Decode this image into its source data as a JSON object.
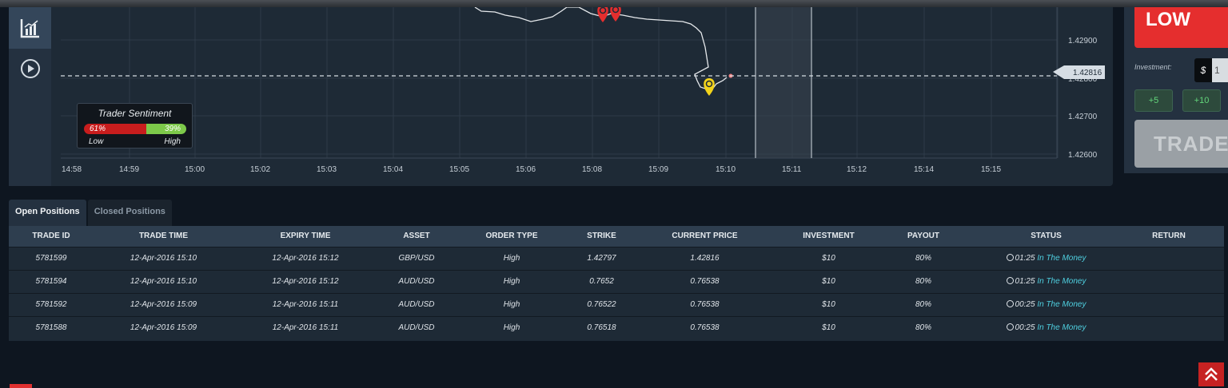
{
  "chart": {
    "price_labels": [
      "1.42900",
      "1.42800",
      "1.42700",
      "1.42600"
    ],
    "current_price": "1.42816",
    "time_labels": [
      "14:58",
      "14:59",
      "15:00",
      "15:02",
      "15:03",
      "15:04",
      "15:05",
      "15:06",
      "15:08",
      "15:09",
      "15:10",
      "15:11",
      "15:12",
      "15:14",
      "15:15"
    ],
    "line_color": "#ffffff",
    "marker_colors": {
      "down": "#e52e2e",
      "up": "#f2d31b"
    }
  },
  "sentiment": {
    "title": "Trader Sentiment",
    "low_pct": "61%",
    "high_pct": "39%",
    "low_value": 61,
    "low_label": "Low",
    "high_label": "High"
  },
  "trade_panel": {
    "low_label": "LOW",
    "investment_label": "Investment:",
    "currency": "$",
    "investment_value": "1",
    "inc5": "+5",
    "inc10": "+10",
    "trade_label": "TRADE"
  },
  "tabs": [
    "Open Positions",
    "Closed Positions"
  ],
  "table": {
    "headers": [
      "TRADE ID",
      "TRADE TIME",
      "EXPIRY TIME",
      "ASSET",
      "ORDER TYPE",
      "STRIKE",
      "CURRENT PRICE",
      "INVESTMENT",
      "PAYOUT",
      "STATUS",
      "RETURN"
    ],
    "rows": [
      {
        "id": "5781599",
        "trade_time": "12-Apr-2016 15:10",
        "expiry": "12-Apr-2016 15:12",
        "asset": "GBP/USD",
        "type": "High",
        "strike": "1.42797",
        "current": "1.42816",
        "investment": "$10",
        "payout": "80%",
        "timer": "01:25",
        "status": "In The Money",
        "return": ""
      },
      {
        "id": "5781594",
        "trade_time": "12-Apr-2016 15:10",
        "expiry": "12-Apr-2016 15:12",
        "asset": "AUD/USD",
        "type": "High",
        "strike": "0.7652",
        "current": "0.76538",
        "investment": "$10",
        "payout": "80%",
        "timer": "01:25",
        "status": "In The Money",
        "return": ""
      },
      {
        "id": "5781592",
        "trade_time": "12-Apr-2016 15:09",
        "expiry": "12-Apr-2016 15:11",
        "asset": "AUD/USD",
        "type": "High",
        "strike": "0.76522",
        "current": "0.76538",
        "investment": "$10",
        "payout": "80%",
        "timer": "00:25",
        "status": "In The Money",
        "return": ""
      },
      {
        "id": "5781588",
        "trade_time": "12-Apr-2016 15:09",
        "expiry": "12-Apr-2016 15:11",
        "asset": "AUD/USD",
        "type": "High",
        "strike": "0.76518",
        "current": "0.76538",
        "investment": "$10",
        "payout": "80%",
        "timer": "00:25",
        "status": "In The Money",
        "return": ""
      }
    ]
  },
  "icons": {
    "chart_tool": "bar-chart-icon",
    "play_tool": "play-circle-icon",
    "clock": "clock-icon",
    "scroll_top": "chevrons-up-icon"
  }
}
